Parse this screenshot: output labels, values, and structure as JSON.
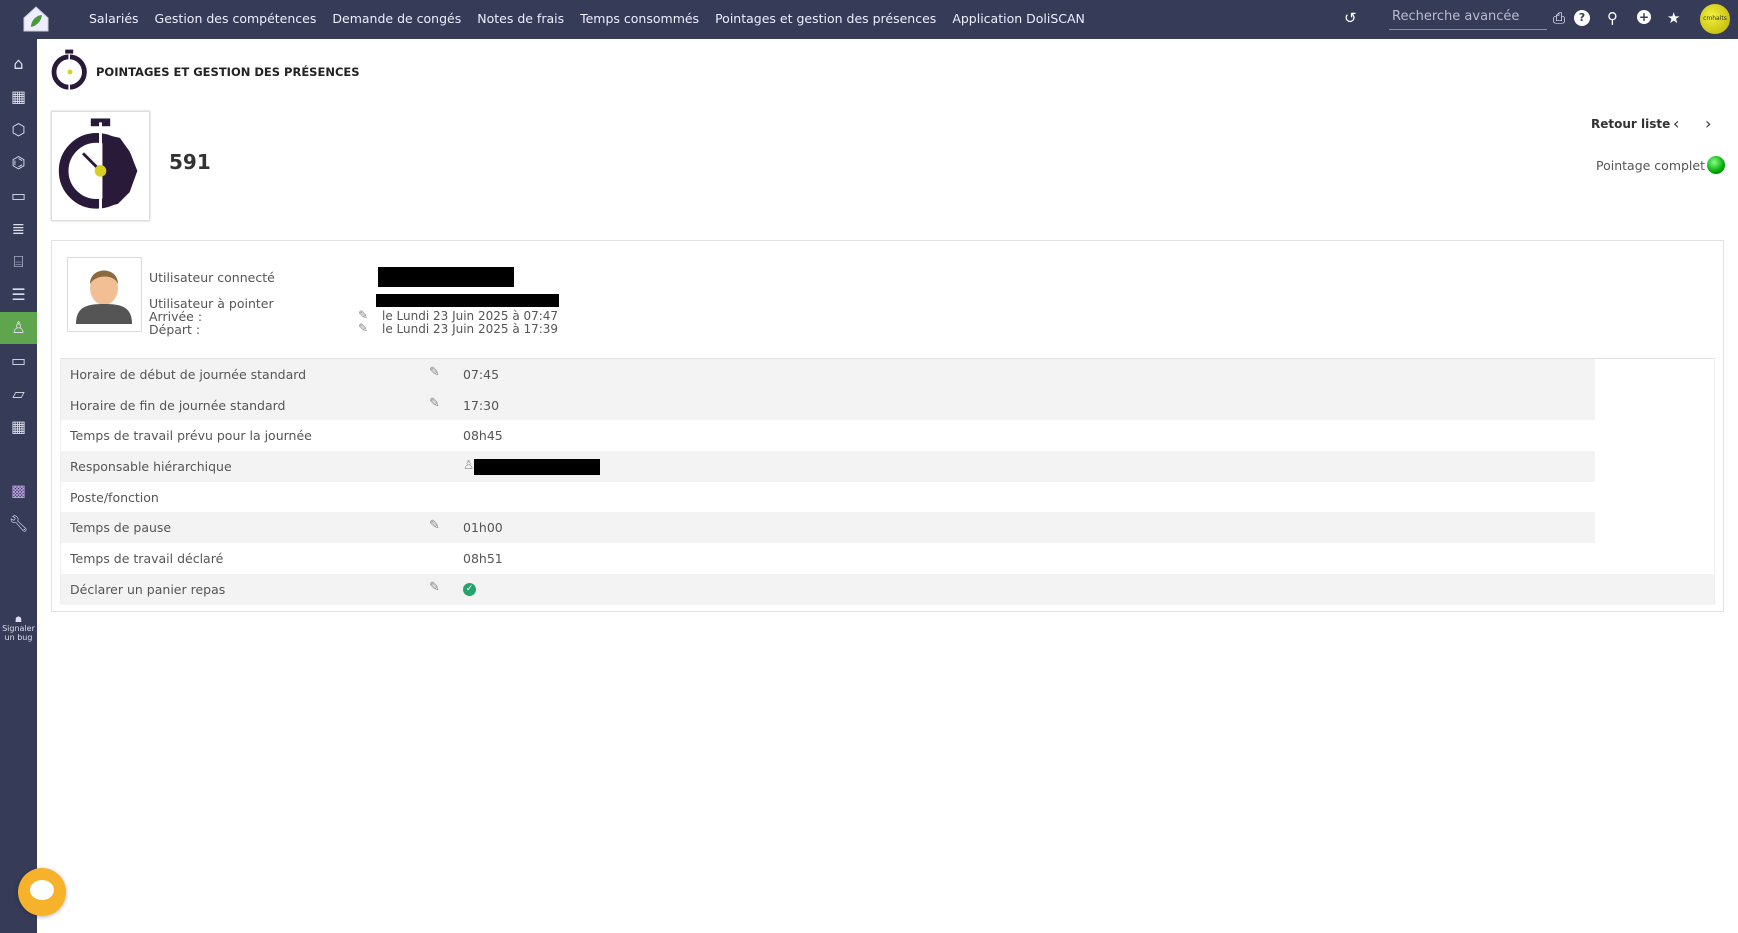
{
  "topbar": {
    "menu": [
      "Salariés",
      "Gestion des compétences",
      "Demande de congés",
      "Notes de frais",
      "Temps consommés",
      "Pointages et gestion des présences",
      "Application DoliSCAN"
    ],
    "search_placeholder": "Recherche avancée",
    "avatar_text": "cmhalts"
  },
  "sidebar": {
    "bug_label": "Signaler un bug"
  },
  "page": {
    "title": "POINTAGES ET GESTION DES PRÉSENCES",
    "ref": "591",
    "back_label": "Retour liste",
    "status": "Pointage complet",
    "status_color": "#22aa22"
  },
  "user": {
    "connected_label": "Utilisateur connecté",
    "to_clock_label": "Utilisateur à pointer",
    "arrival_label": "Arrivée :",
    "departure_label": "Départ :",
    "arrival": "le Lundi 23 Juin 2025 à 07:47",
    "departure": "le Lundi 23 Juin 2025 à 17:39"
  },
  "fields": [
    {
      "label": "Horaire de début de journée standard",
      "value": "07:45",
      "editable": true
    },
    {
      "label": "Horaire de fin de journée standard",
      "value": "17:30",
      "editable": true
    },
    {
      "label": "Temps de travail prévu pour la journée",
      "value": "08h45",
      "editable": false
    },
    {
      "label": "Responsable hiérarchique",
      "value": "",
      "editable": false
    },
    {
      "label": "Poste/fonction",
      "value": "",
      "editable": false
    },
    {
      "label": "Temps de pause",
      "value": "01h00",
      "editable": true
    },
    {
      "label": "Temps de travail déclaré",
      "value": "08h51",
      "editable": false
    },
    {
      "label": "Déclarer un panier repas",
      "value": "",
      "editable": true
    }
  ]
}
